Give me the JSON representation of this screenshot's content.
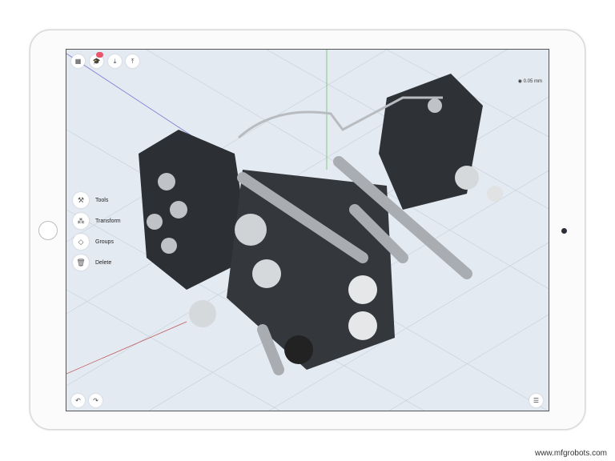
{
  "toolbar": {
    "icons": [
      "grid-icon",
      "learn-icon",
      "import-icon",
      "share-icon"
    ]
  },
  "readout": {
    "label": "0.05 mm"
  },
  "side_menu": [
    {
      "label": "Tools",
      "icon": "wrench-icon"
    },
    {
      "label": "Transform",
      "icon": "transform-icon"
    },
    {
      "label": "Groups",
      "icon": "layers-icon"
    },
    {
      "label": "Delete",
      "icon": "trash-icon"
    }
  ],
  "bottom": {
    "icons": [
      "undo-icon",
      "redo-icon",
      "settings-icon"
    ]
  },
  "watermark": "www.mfgrobots.com",
  "colors": {
    "badge": "#e8566c",
    "background": "#e4eaf1"
  }
}
